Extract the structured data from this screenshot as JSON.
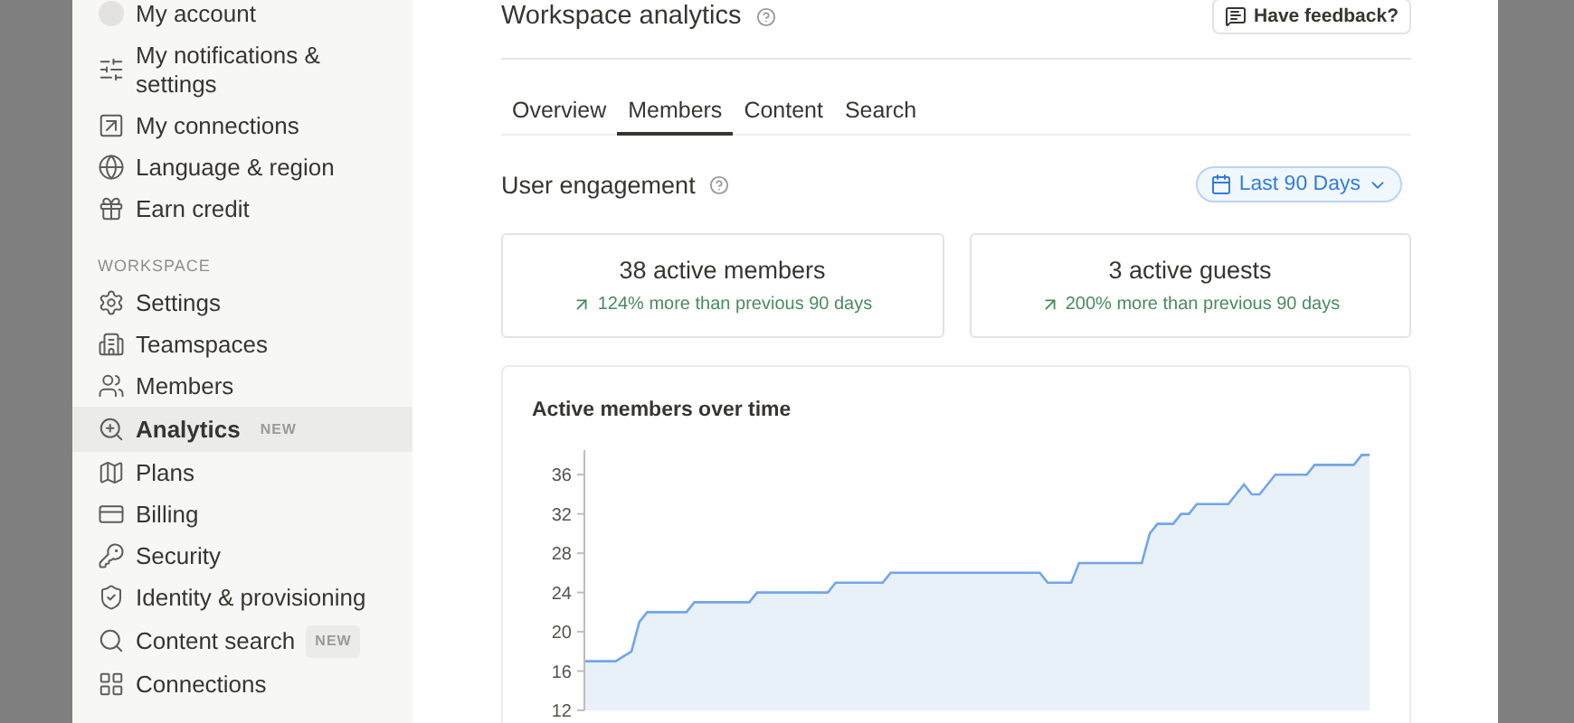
{
  "sidebar": {
    "account_items": [
      {
        "label": "My account",
        "selected": false
      },
      {
        "label": "My notifications & settings",
        "selected": false
      },
      {
        "label": "My connections",
        "selected": false
      },
      {
        "label": "Language & region",
        "selected": false
      },
      {
        "label": "Earn credit",
        "selected": false
      }
    ],
    "section_label": "WORKSPACE",
    "workspace_items": [
      {
        "label": "Settings",
        "selected": false
      },
      {
        "label": "Teamspaces",
        "selected": false
      },
      {
        "label": "Members",
        "selected": false
      },
      {
        "label": "Analytics",
        "selected": true,
        "badge": "NEW"
      },
      {
        "label": "Plans",
        "selected": false
      },
      {
        "label": "Billing",
        "selected": false
      },
      {
        "label": "Security",
        "selected": false
      },
      {
        "label": "Identity & provisioning",
        "selected": false
      },
      {
        "label": "Content search",
        "selected": false,
        "badge": "NEW"
      },
      {
        "label": "Connections",
        "selected": false
      }
    ]
  },
  "header": {
    "title": "Workspace analytics",
    "feedback_button": "Have feedback?"
  },
  "tabs": [
    {
      "label": "Overview",
      "selected": false
    },
    {
      "label": "Members",
      "selected": true
    },
    {
      "label": "Content",
      "selected": false
    },
    {
      "label": "Search",
      "selected": false
    }
  ],
  "section": {
    "title": "User engagement",
    "date_range": "Last 90 Days"
  },
  "stats": [
    {
      "value": "38 active members",
      "change": "124% more than previous 90 days"
    },
    {
      "value": "3 active guests",
      "change": "200% more than previous 90 days"
    }
  ],
  "chart": {
    "title": "Active members over time",
    "chart_data": {
      "type": "area",
      "series": [
        {
          "color": "#73a5e8",
          "values": [
            17,
            17,
            17,
            17,
            17,
            17.5,
            18,
            21,
            22,
            22,
            22,
            22,
            22,
            22,
            23,
            23,
            23,
            23,
            23,
            23,
            23,
            23,
            24,
            24,
            24,
            24,
            24,
            24,
            24,
            24,
            24,
            24,
            25,
            25,
            25,
            25,
            25,
            25,
            25,
            26,
            26,
            26,
            26,
            26,
            26,
            26,
            26,
            26,
            26,
            26,
            26,
            26,
            26,
            26,
            26,
            26,
            26,
            26,
            26,
            25,
            25,
            25,
            25,
            27,
            27,
            27,
            27,
            27,
            27,
            27,
            27,
            27,
            30,
            31,
            31,
            31,
            32,
            32,
            33,
            33,
            33,
            33,
            33,
            34,
            35,
            34,
            34,
            35,
            36,
            36,
            36,
            36,
            36,
            37,
            37,
            37,
            37,
            37,
            37,
            38,
            38
          ]
        }
      ],
      "ylim": [
        12,
        38.5
      ],
      "yticks": [
        12,
        16,
        20,
        24,
        28,
        32,
        36
      ]
    }
  }
}
